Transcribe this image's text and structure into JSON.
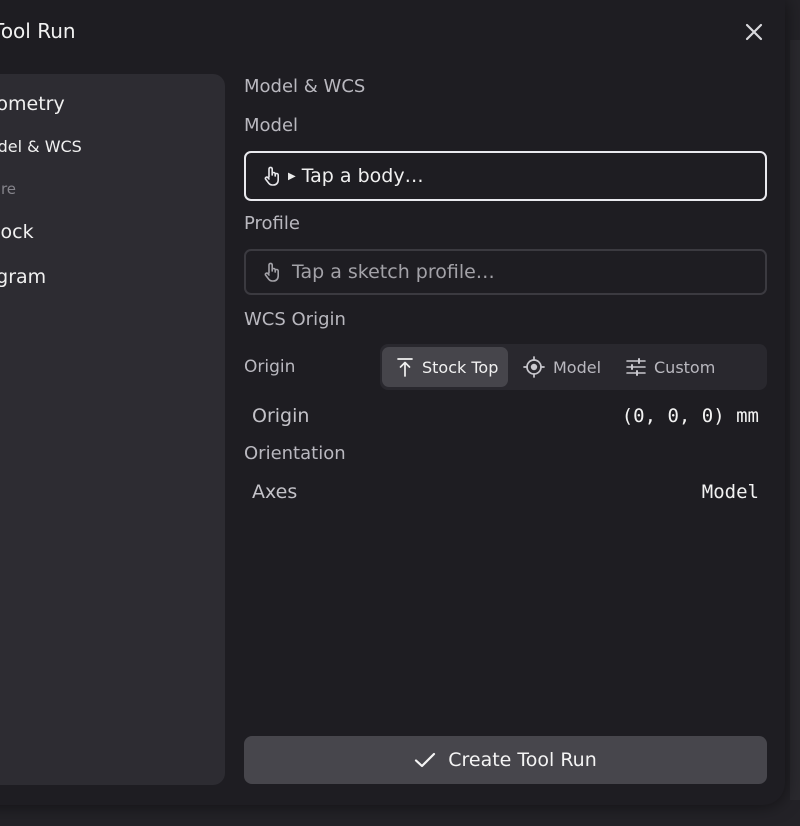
{
  "dialog": {
    "title": "Tool Run"
  },
  "sidebar": {
    "items": [
      {
        "label": "Geometry"
      },
      {
        "label": "Model & WCS"
      },
      {
        "label": "Fixture"
      },
      {
        "label": "Stock"
      },
      {
        "label": "Program"
      }
    ]
  },
  "main": {
    "section_title": "Model & WCS",
    "model": {
      "label": "Model",
      "placeholder": "Tap a body…"
    },
    "profile": {
      "label": "Profile",
      "placeholder": "Tap a sketch profile…"
    },
    "wcs_origin": {
      "title": "WCS Origin",
      "origin_label": "Origin",
      "options": [
        {
          "label": "Stock Top",
          "icon": "align-top-icon",
          "selected": true
        },
        {
          "label": "Model",
          "icon": "target-icon",
          "selected": false
        },
        {
          "label": "Custom",
          "icon": "sliders-icon",
          "selected": false
        }
      ],
      "readout_label": "Origin",
      "readout_value": "(0, 0, 0) mm"
    },
    "orientation": {
      "title": "Orientation",
      "axes_label": "Axes",
      "axes_value": "Model"
    },
    "create_button": "Create Tool Run"
  },
  "colors": {
    "dialog_bg": "#1e1d22",
    "sidebar_bg": "#2d2c32",
    "accent_border": "#e9e9ee"
  }
}
